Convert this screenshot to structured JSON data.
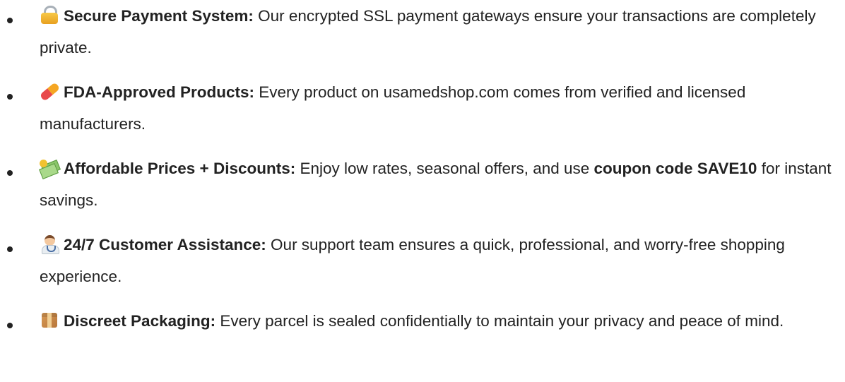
{
  "features": [
    {
      "icon": "lock-icon",
      "title": "Secure Payment System:",
      "text": " Our encrypted SSL payment gateways ensure your transactions are completely private."
    },
    {
      "icon": "pill-icon",
      "title": "FDA-Approved Products:",
      "text": " Every product on usamedshop.com comes from verified and licensed manufacturers."
    },
    {
      "icon": "money-with-wings-icon",
      "title": "Affordable Prices + Discounts:",
      "text": " Enjoy low rates, seasonal offers, and use ",
      "highlight": "coupon code SAVE10",
      "text_after": " for instant savings."
    },
    {
      "icon": "health-worker-icon",
      "title": "24/7 Customer Assistance:",
      "text": " Our support team ensures a quick, professional, and worry-free shopping experience."
    },
    {
      "icon": "package-icon",
      "title": "Discreet Packaging:",
      "text": " Every parcel is sealed confidentially to maintain your privacy and peace of mind."
    }
  ]
}
